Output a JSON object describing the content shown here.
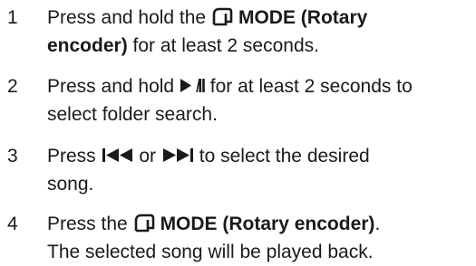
{
  "steps": [
    {
      "number": "1",
      "line1_pre": "Press and hold the",
      "line1_bold": "MODE (Rotary",
      "line2_bold": "encoder)",
      "line2_post": "for at least 2 seconds.",
      "icon": "mode-icon"
    },
    {
      "number": "2",
      "line1_pre": "Press and hold",
      "line1_post": "for at least 2 seconds to",
      "line2": "select folder search.",
      "icon": "play-pause-icon"
    },
    {
      "number": "3",
      "line1_pre": "Press",
      "line1_mid": "or",
      "line1_post": "to select the desired",
      "line2": "song.",
      "icons": [
        "previous-track-icon",
        "next-track-icon"
      ]
    },
    {
      "number": "4",
      "line1_pre": "Press the",
      "line1_bold": "MODE (Rotary encoder)",
      "line1_end": ".",
      "line2": "The selected song will be played back.",
      "icon": "mode-icon"
    }
  ]
}
